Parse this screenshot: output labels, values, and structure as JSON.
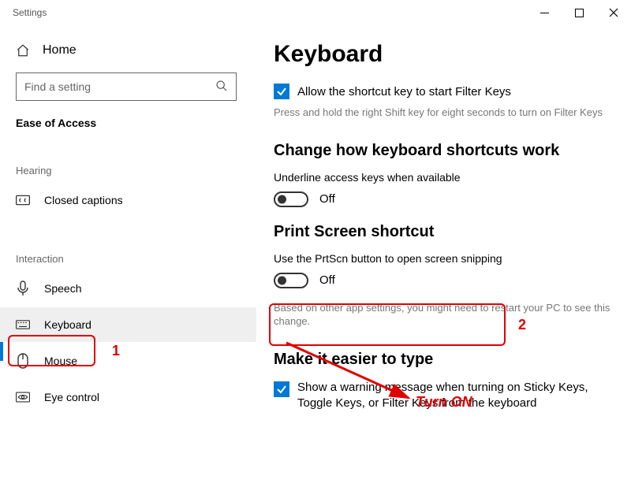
{
  "titlebar": {
    "title": "Settings"
  },
  "sidebar": {
    "home": "Home",
    "search_placeholder": "Find a setting",
    "group": "Ease of Access",
    "sections": {
      "hearing": "Hearing",
      "interaction": "Interaction"
    },
    "hearing_items": [
      {
        "icon": "cc",
        "label": "Closed captions"
      }
    ],
    "interaction_items": [
      {
        "icon": "speech",
        "label": "Speech"
      },
      {
        "icon": "keyboard",
        "label": "Keyboard",
        "selected": true
      },
      {
        "icon": "mouse",
        "label": "Mouse"
      },
      {
        "icon": "eye",
        "label": "Eye control"
      }
    ]
  },
  "main": {
    "title": "Keyboard",
    "filter_keys": {
      "label": "Allow the shortcut key to start Filter Keys",
      "help": "Press and hold the right Shift key for eight seconds to turn on Filter Keys"
    },
    "shortcuts": {
      "heading": "Change how keyboard shortcuts work",
      "underline": "Underline access keys when available",
      "toggle_state": "Off"
    },
    "prtscn": {
      "heading": "Print Screen shortcut",
      "label": "Use the PrtScn button to open screen snipping",
      "toggle_state": "Off",
      "note": "Based on other app settings, you might need to restart your PC to see this change."
    },
    "easier": {
      "heading": "Make it easier to type",
      "warning": "Show a warning message when turning on Sticky Keys, Toggle Keys, or Filter Keys from the keyboard"
    }
  },
  "annotations": {
    "num1": "1",
    "num2": "2",
    "turn_on": "Turn ON"
  }
}
